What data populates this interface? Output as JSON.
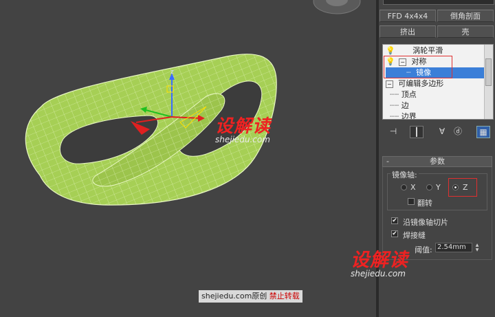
{
  "toolbar_buttons": {
    "ffd": "FFD 4x4x4",
    "chamfer_section": "倒角剖面",
    "extrude": "挤出",
    "shell": "壳"
  },
  "modifier_stack": {
    "items": [
      {
        "label": "涡轮平滑",
        "selected": false
      },
      {
        "label": "对称",
        "selected": false
      },
      {
        "label": "镜像",
        "selected": true
      },
      {
        "label": "可编辑多边形",
        "selected": false
      },
      {
        "label": "顶点",
        "selected": false
      },
      {
        "label": "边",
        "selected": false
      },
      {
        "label": "边界",
        "selected": false
      }
    ]
  },
  "params": {
    "rollout_toggle": "-",
    "rollout_title": "参数",
    "mirror_axis_label": "镜像轴:",
    "axis_x": "X",
    "axis_y": "Y",
    "axis_z": "Z",
    "selected_axis": "Z",
    "flip_label": "翻转",
    "flip_checked": false,
    "slice_label": "沿镜像轴切片",
    "slice_checked": true,
    "weld_label": "焊接缝",
    "weld_checked": true,
    "threshold_label": "阈值:",
    "threshold_value": "2.54mm"
  },
  "viewport": {
    "gizmo_axis_label": "z",
    "model_color": "#a6cf55"
  },
  "watermark": {
    "logo_cn": "设解读",
    "site": "shejiedu.com",
    "credit_site": "shejiedu.com",
    "credit_original": "原创",
    "credit_forbid": "禁止转载"
  },
  "colors": {
    "accent_red": "#e03030",
    "selection_blue": "#3b7fd8"
  }
}
